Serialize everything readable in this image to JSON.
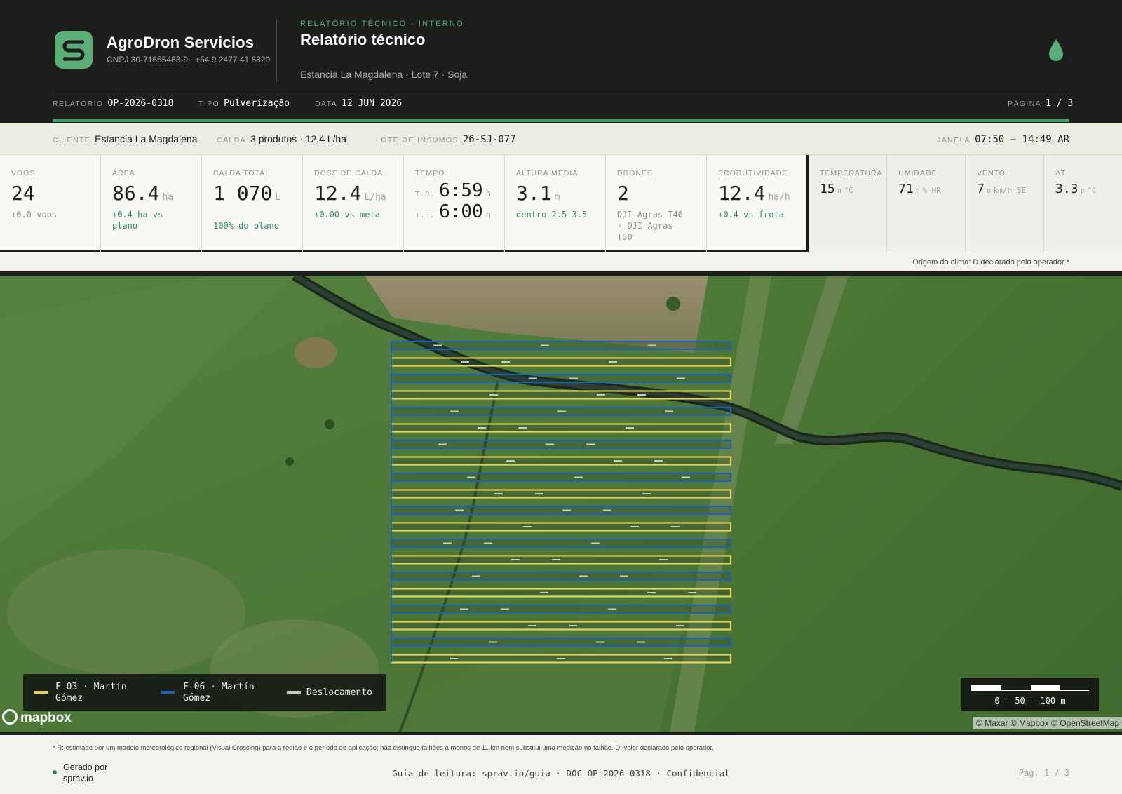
{
  "header": {
    "company_name": "AgroDron Servicios",
    "cnpj": "CNPJ 30-71655483-9",
    "phone": "+54 9 2477 41 8820",
    "eyebrow": "RELATÓRIO TÉCNICO · INTERNO",
    "title": "Relatório técnico",
    "subtitle": "Estancia La Magdalena · Lote 7 · Soja",
    "meta": {
      "relatorio_label": "RELATÓRIO",
      "relatorio_value": "OP-2026-0318",
      "tipo_label": "TIPO",
      "tipo_value": "Pulverização",
      "data_label": "DATA",
      "data_value": "12 JUN 2026",
      "pagina_label": "PÁGINA",
      "pagina_value": "1 / 3"
    },
    "brand_color": "#5cae78",
    "icons": [
      "app-logo-icon",
      "water-drop-icon"
    ]
  },
  "client_row": {
    "cliente_label": "CLIENTE",
    "cliente_value": "Estancia La Magdalena",
    "calda_label": "CALDA",
    "calda_value": "3 produtos · 12.4 L/ha",
    "lote_label": "LOTE DE INSUMOS",
    "lote_value": "26-SJ-077",
    "janela_label": "JANELA",
    "janela_value": "07:50 – 14:49 AR"
  },
  "kpis": {
    "voos": {
      "label": "VOOS",
      "value": "24",
      "unit": "",
      "note": "+0.0 voos"
    },
    "area": {
      "label": "ÁREA",
      "value": "86.4",
      "unit": "ha",
      "note": "+0.4 ha vs plano"
    },
    "calda_total": {
      "label": "CALDA TOTAL",
      "value": "1 070",
      "unit": "L",
      "note": "100% do plano"
    },
    "dose": {
      "label": "DOSE DE CALDA",
      "value": "12.4",
      "unit": "L/ha",
      "note": "+0.00 vs meta"
    },
    "tempo": {
      "label": "TEMPO",
      "to_label": "T.O.",
      "to_value": "6:59",
      "te_label": "T.E.",
      "te_value": "6:00",
      "unit": "h"
    },
    "altura": {
      "label": "ALTURA MÉDIA",
      "value": "3.1",
      "unit": "m",
      "note": "dentro 2.5–3.5"
    },
    "drones": {
      "label": "DRONES",
      "value": "2",
      "note": "DJI Agras T40 · DJI Agras T50"
    },
    "produtividade": {
      "label": "PRODUTIVIDADE",
      "value": "12.4",
      "unit": "ha/h",
      "note": "+0.4 vs frota"
    },
    "temperatura": {
      "label": "TEMPERATURA",
      "value": "15",
      "flag": "D",
      "unit": "°C"
    },
    "umidade": {
      "label": "UMIDADE",
      "value": "71",
      "flag": "D",
      "unit": "% HR"
    },
    "vento": {
      "label": "VENTO",
      "value": "7",
      "flag": "D",
      "unit": "km/h SE"
    },
    "delta_t": {
      "label": "ΔT",
      "value": "3.3",
      "flag": "D",
      "unit": "°C"
    }
  },
  "origem_clima": "Origem do clima: D declarado pelo operador *",
  "map": {
    "legend": {
      "f03": "F-03 · Martín Gómez",
      "f06": "F-06 · Martín Gómez",
      "desloc": "Deslocamento"
    },
    "colors": {
      "f03": "#e6d35a",
      "f06": "#1f62b0",
      "desloc": "#c9cbc6"
    },
    "scale_label": "0 – 50 – 100 m",
    "logo_text": "mapbox",
    "attribution": "© Maxar © Mapbox © OpenStreetMap"
  },
  "footer": {
    "footnote": "* R: estimado por um modelo meteorológico regional (Visual Crossing) para a região e o período de aplicação; não distingue talhões a menos de 11 km nem substitui uma medição no talhão. D: valor declarado pelo operador.",
    "generated": "Gerado por sprav.io",
    "guide": "Guia de leitura: sprav.io/guia · DOC OP-2026-0318 · Confidencial",
    "page": "Pág. 1 / 3"
  }
}
